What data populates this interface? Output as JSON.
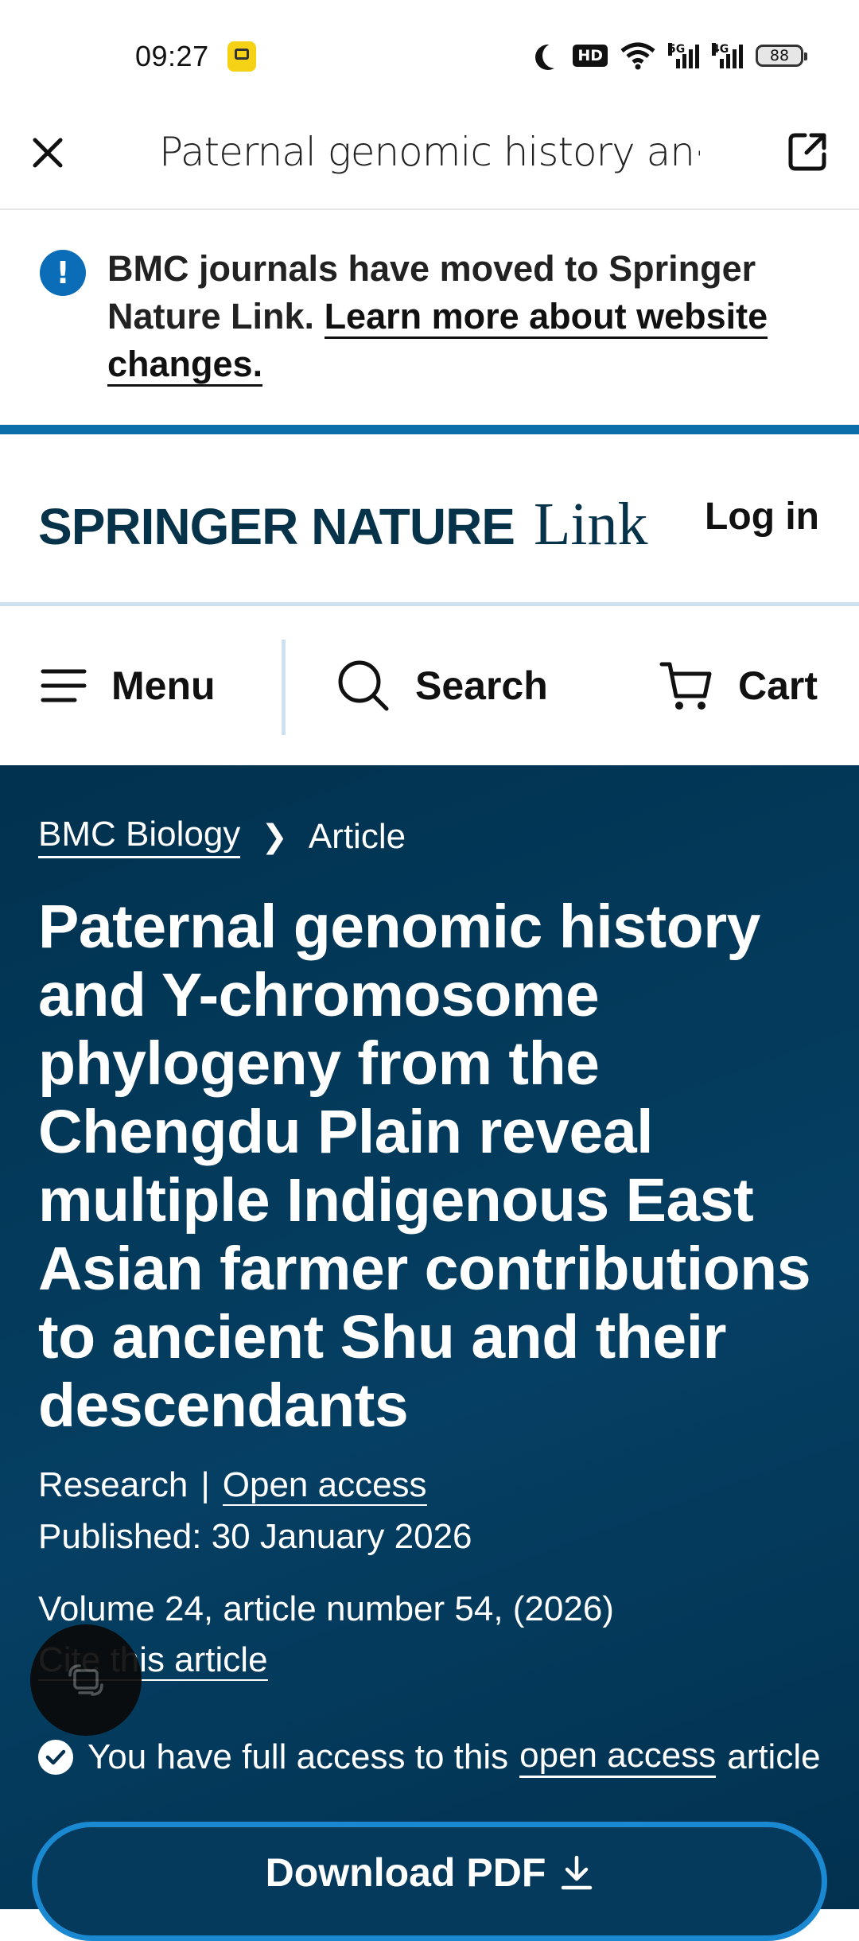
{
  "status_bar": {
    "time": "09:27",
    "hd_label": "HD",
    "signal_5g": "5G",
    "signal_4g": "4G",
    "battery": "88"
  },
  "browser": {
    "title": "Paternal genomic history an⋯"
  },
  "notice": {
    "icon": "!",
    "text": "BMC journals have moved to Springer Nature Link. ",
    "link_text": "Learn more about website changes."
  },
  "header": {
    "logo_main": "SPRINGER NATURE",
    "logo_link": "Link",
    "login": "Log in"
  },
  "nav": {
    "menu": "Menu",
    "search": "Search",
    "cart": "Cart"
  },
  "article": {
    "breadcrumb_journal": "BMC Biology",
    "breadcrumb_current": "Article",
    "title": "Paternal genomic history and Y-chromosome phylogeny from the Chengdu Plain reveal multiple Indigenous East Asian farmer contributions to ancient Shu and their descendants",
    "type": "Research",
    "separator": "|",
    "open_access": "Open access",
    "published": "Published: 30 January 2026",
    "volume": "Volume 24, article number 54, (2026)",
    "cite": "Cite this article",
    "access_prefix": "You have full access to this",
    "access_link": "open access",
    "access_suffix": "article",
    "download": "Download PDF"
  },
  "colors": {
    "brand_navy": "#07334a",
    "accent_blue": "#0a6eab",
    "hero_bg": "#053f63",
    "button_border": "#1a89d2"
  }
}
